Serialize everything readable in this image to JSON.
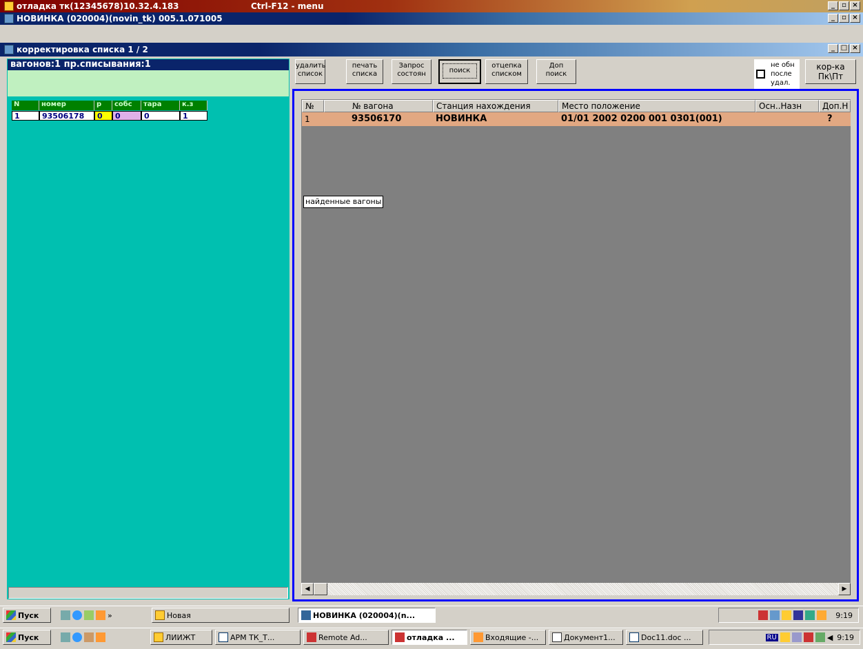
{
  "titlebar1": {
    "title": "отладка тк(12345678)10.32.4.183",
    "menu_hint": "Ctrl-F12 - menu"
  },
  "titlebar2": {
    "title": "НОВИНКА (020004)(novin_tk) 005.1.071005"
  },
  "titlebar3": {
    "title": "корректировка списка 1 / 2"
  },
  "left": {
    "status": "вагонов:1 пр.списывания:1"
  },
  "left_table": {
    "headers": [
      "N",
      "номер",
      "р",
      "собс",
      "тара",
      "к.з"
    ],
    "row": [
      "1",
      "93506178",
      "0",
      "0",
      "0",
      "1"
    ]
  },
  "toolbar": {
    "delete": [
      "удалить",
      "список"
    ],
    "print": [
      "печать",
      "списка"
    ],
    "request": [
      "Запрос",
      "состоян"
    ],
    "search": "поиск",
    "uncouple": [
      "отцепка",
      "списком"
    ],
    "extra_search": [
      "Доп",
      "поиск"
    ],
    "no_update": [
      "не обн",
      "после",
      "удал."
    ],
    "correction": [
      "кор-ка",
      "Пк\\Пт"
    ]
  },
  "right_table": {
    "headers": [
      "№",
      "№ вагона",
      "Станция нахождения",
      "Место положение",
      "Осн..Назн",
      "Доп.Н"
    ],
    "row": [
      "1",
      "93506170",
      "НОВИНКА",
      "01/01  2002  0200 001 0301(001)",
      "",
      "?"
    ]
  },
  "tooltip": "найденные вагоны",
  "taskbar_inner": {
    "start": "Пуск",
    "folder": "Новая",
    "task": "НОВИНКА (020004)(n...",
    "clock": "9:19"
  },
  "taskbar_outer": {
    "start": "Пуск",
    "tasks": [
      "ЛИИЖТ",
      "АРМ ТК_Т...",
      "Remote Ad...",
      "отладка ...",
      "Входящие -...",
      "Документ1...",
      "Doc11.doc ..."
    ],
    "lang": "RU",
    "clock": "9:19"
  },
  "colors": {
    "titlebar": "#800000",
    "teal": "#00c0b0",
    "dark_grid": "#808080",
    "row_highlight": "#e2a882",
    "frame_blue": "#0000ff"
  }
}
